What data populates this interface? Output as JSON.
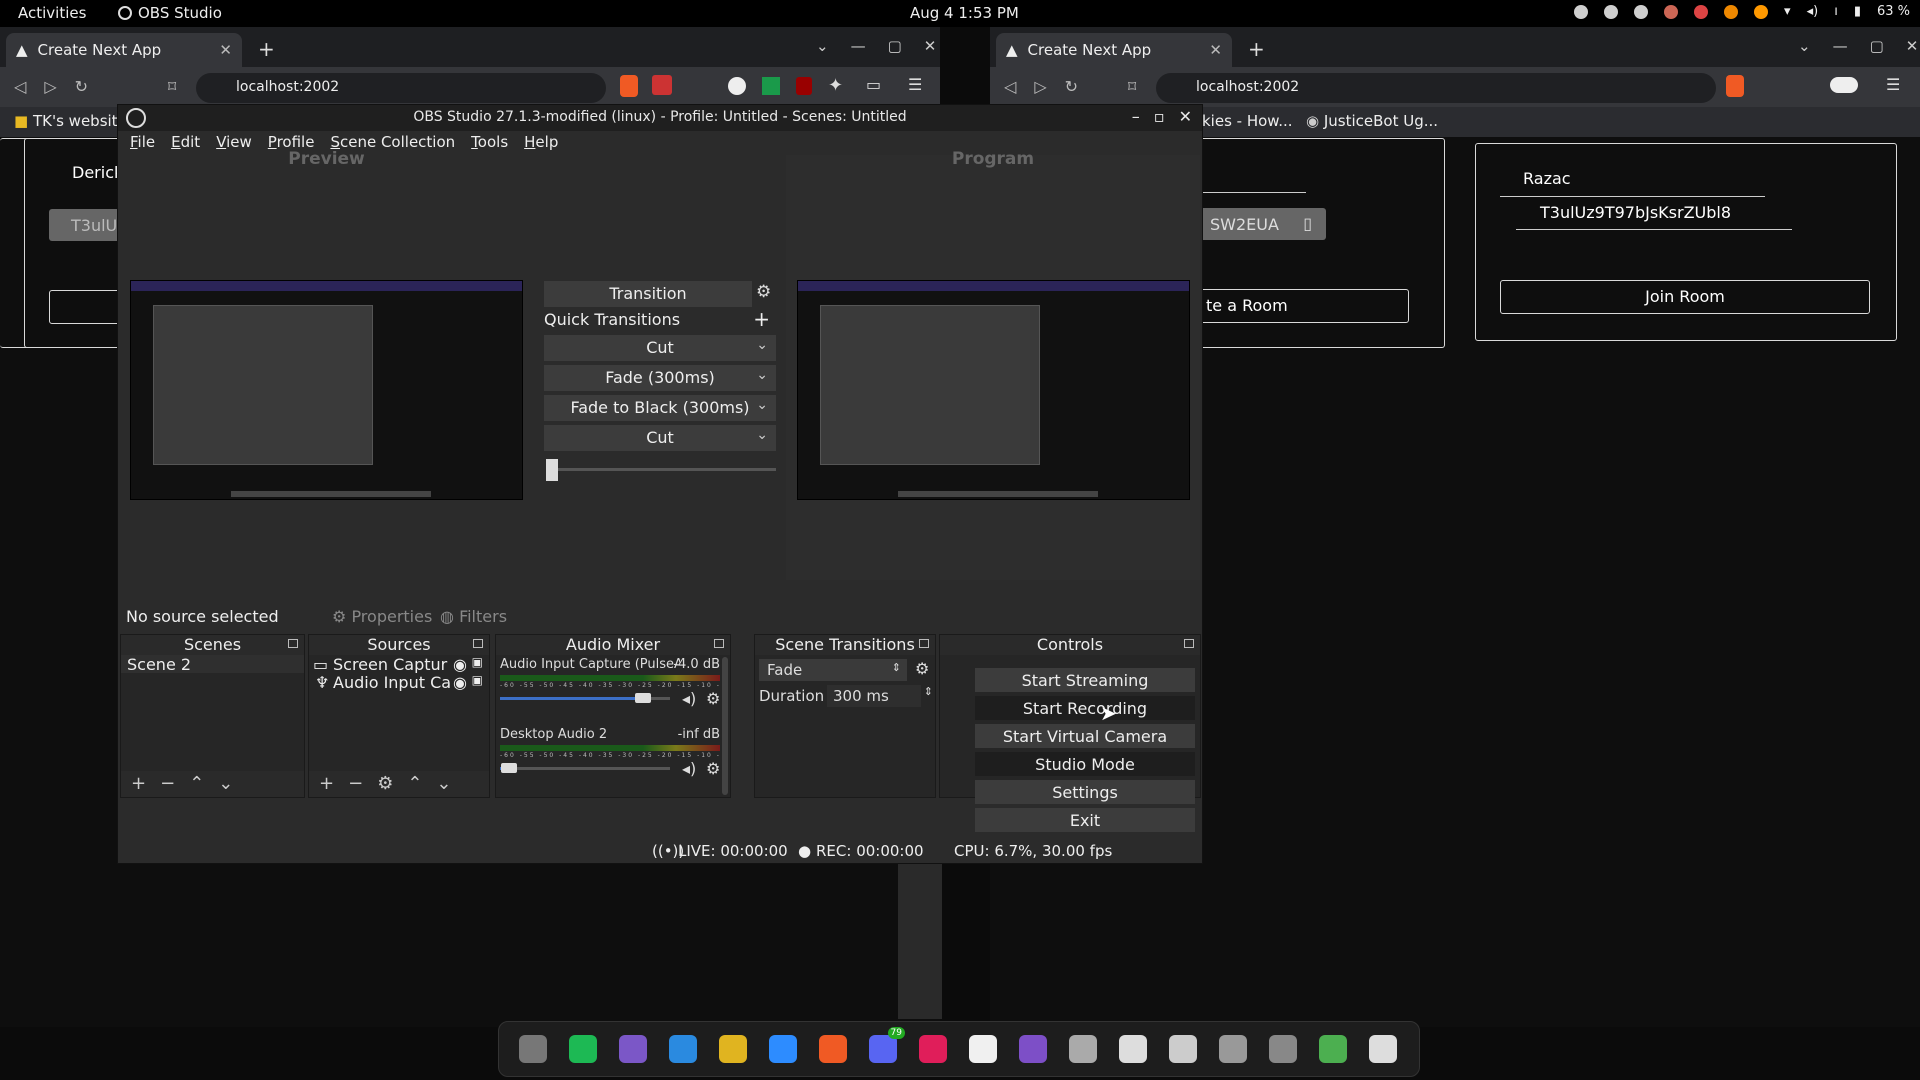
{
  "topbar": {
    "activities": "Activities",
    "app": "OBS Studio",
    "clock": "Aug 4  1:53 PM",
    "battery": "63 %"
  },
  "browser_left": {
    "tab_title": "Create Next App",
    "url": "localhost:2002",
    "bookmark": "TK's website",
    "page": {
      "name": "Derick",
      "code_partial": "T3ulU",
      "code_tail": "SW2EUA",
      "create_label": "te a Room"
    }
  },
  "browser_right": {
    "tab_title": "Create Next App",
    "url": "localhost:2002",
    "bookmark1": "kies - How...",
    "bookmark2": "JusticeBot Ug...",
    "page": {
      "name": "Razac",
      "code": "T3ulUz9T97bJsKsrZUbl8",
      "join_label": "Join Room"
    }
  },
  "obs": {
    "title": "OBS Studio 27.1.3-modified (linux) - Profile: Untitled - Scenes: Untitled",
    "menu": [
      "File",
      "Edit",
      "View",
      "Profile",
      "Scene Collection",
      "Tools",
      "Help"
    ],
    "preview_label": "Preview",
    "program_label": "Program",
    "transition_label": "Transition",
    "quick_transitions_label": "Quick Transitions",
    "quick_transitions": [
      "Cut",
      "Fade (300ms)",
      "Fade to Black (300ms)",
      "Cut"
    ],
    "no_source": "No source selected",
    "properties": "Properties",
    "filters": "Filters",
    "docks": {
      "scenes": {
        "title": "Scenes",
        "items": [
          "Scene 2"
        ]
      },
      "sources": {
        "title": "Sources",
        "items": [
          "Screen Captur",
          "Audio Input Ca"
        ]
      },
      "mixer": {
        "title": "Audio Mixer",
        "channels": [
          {
            "name": "Audio Input Capture (PulseA",
            "db": "-4.0 dB",
            "volume": 0.84
          },
          {
            "name": "Desktop Audio 2",
            "db": "-inf dB",
            "volume": 0.05
          }
        ],
        "tick_labels": "-60 -55 -50 -45 -40 -35 -30 -25 -20 -15 -10 -5 0"
      },
      "transitions": {
        "title": "Scene Transitions",
        "selected": "Fade",
        "duration_label": "Duration",
        "duration_value": "300 ms"
      },
      "controls": {
        "title": "Controls",
        "buttons": [
          "Start Streaming",
          "Start Recording",
          "Start Virtual Camera",
          "Studio Mode",
          "Settings",
          "Exit"
        ]
      }
    },
    "status": {
      "live": "LIVE: 00:00:00",
      "rec": "REC: 00:00:00",
      "cpu": "CPU: 6.7%, 30.00 fps"
    }
  },
  "taskbar": {
    "discord_badge": "79",
    "apps": [
      "files-icon",
      "spotify-icon",
      "github-icon",
      "vscode-icon",
      "chrome-icon",
      "zoom-icon",
      "brave-icon",
      "discord-icon",
      "slack-icon",
      "notes-icon",
      "tor-icon",
      "settings-icon",
      "obs-icon",
      "gimp-icon",
      "disk-icon",
      "drive-icon",
      "trash-icon",
      "app-grid-icon"
    ],
    "colors": [
      "#777777",
      "#1db954",
      "#7b57c7",
      "#2a8ae0",
      "#e0b420",
      "#2d8cff",
      "#f05a24",
      "#5865f2",
      "#e01e5a",
      "#f0f0f0",
      "#7d4fc7",
      "#aaaaaa",
      "#dddddd",
      "#cccccc",
      "#999999",
      "#888888",
      "#4caf50",
      "#dddddd"
    ]
  }
}
